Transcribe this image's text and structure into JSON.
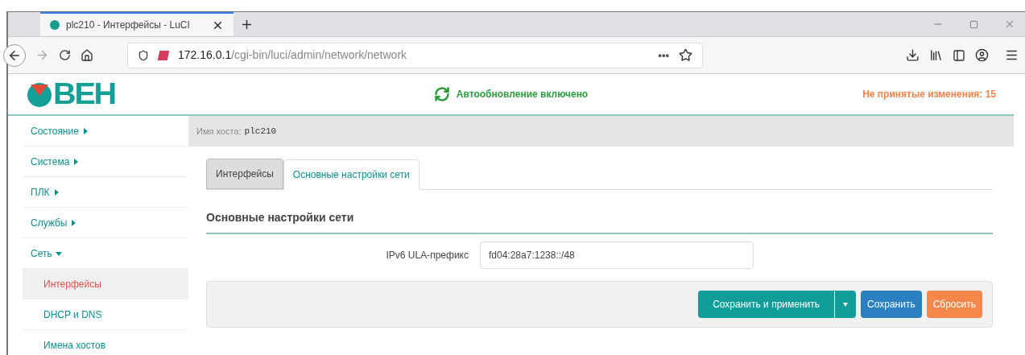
{
  "browser": {
    "tab_title": "plc210 - Интерфейсы - LuCI",
    "url_host": "172.16.0.1",
    "url_path": "/cgi-bin/luci/admin/network/network",
    "more": "•••"
  },
  "header": {
    "logo": "ВЕН",
    "autorefresh": "Автообновление включено",
    "changes": "Не принятые изменения: 15"
  },
  "sidebar": {
    "items": [
      {
        "label": "Состояние",
        "expanded": false
      },
      {
        "label": "Система",
        "expanded": false
      },
      {
        "label": "ПЛК",
        "expanded": false
      },
      {
        "label": "Службы",
        "expanded": false
      },
      {
        "label": "Сеть",
        "expanded": true,
        "children": [
          {
            "label": "Интерфейсы",
            "selected": true
          },
          {
            "label": "DHCP и DNS",
            "selected": false
          },
          {
            "label": "Имена хостов",
            "selected": false
          }
        ]
      }
    ]
  },
  "hostbar": {
    "label": "Имя хоста:",
    "value": "plc210"
  },
  "tabs": [
    {
      "label": "Интерфейсы",
      "selected": false
    },
    {
      "label": "Основные настройки сети",
      "selected": true
    }
  ],
  "section_title": "Основные настройки сети",
  "fields": [
    {
      "label": "IPv6 ULA-префикс",
      "value": "fd04:28a7:1238::/48"
    }
  ],
  "actions": [
    {
      "label": "Сохранить и применить",
      "kind": "split"
    },
    {
      "label": "Сохранить",
      "kind": "primary"
    },
    {
      "label": "Сбросить",
      "kind": "reset"
    }
  ]
}
